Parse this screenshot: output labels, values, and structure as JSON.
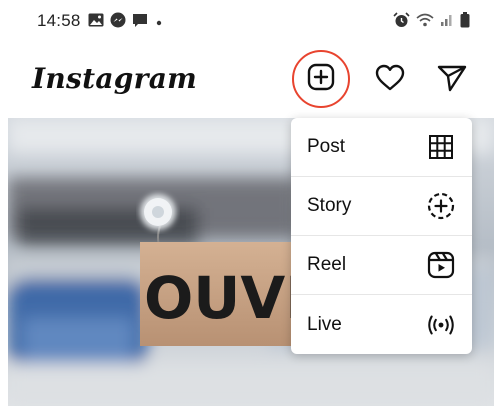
{
  "status_bar": {
    "time": "14:58",
    "left_icons": [
      "gallery-icon",
      "messenger-icon",
      "chat-icon",
      "dot-icon"
    ],
    "right_icons": [
      "alarm-icon",
      "wifi-icon",
      "signal-icon",
      "battery-icon"
    ]
  },
  "header": {
    "logo_text": "Instagram",
    "actions": [
      "create-icon",
      "heart-icon",
      "direct-message-icon"
    ],
    "highlight_color": "#e8442f"
  },
  "feed": {
    "sign_text": "OUVE"
  },
  "create_menu": {
    "items": [
      {
        "label": "Post",
        "icon": "grid-icon"
      },
      {
        "label": "Story",
        "icon": "story-add-icon"
      },
      {
        "label": "Reel",
        "icon": "reel-icon"
      },
      {
        "label": "Live",
        "icon": "live-icon"
      }
    ]
  }
}
